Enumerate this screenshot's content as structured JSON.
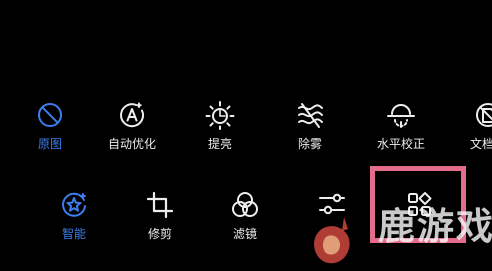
{
  "toolbar_row1": [
    {
      "label": "原图",
      "icon": "prohibited-circle-icon",
      "active": true
    },
    {
      "label": "自动优化",
      "icon": "auto-a-circle-icon",
      "active": false
    },
    {
      "label": "提亮",
      "icon": "sun-icon",
      "active": false
    },
    {
      "label": "除雾",
      "icon": "haze-icon",
      "active": false
    },
    {
      "label": "水平校正",
      "icon": "horizon-level-icon",
      "active": false
    },
    {
      "label": "文档去",
      "icon": "document-correct-icon",
      "active": false
    }
  ],
  "toolbar_row2": [
    {
      "label": "智能",
      "icon": "smart-star-icon",
      "active": true
    },
    {
      "label": "修剪",
      "icon": "crop-icon",
      "active": false
    },
    {
      "label": "滤镜",
      "icon": "filter-circles-icon",
      "active": false
    },
    {
      "label": "",
      "icon": "adjust-sliders-icon",
      "active": false
    },
    {
      "label": "",
      "icon": "more-grid-icon",
      "active": false
    }
  ],
  "watermark": {
    "text": "鹿游戏"
  },
  "colors": {
    "accent": "#3d7df0",
    "highlight": "#e56d8b",
    "text": "#ededed",
    "background": "#000000"
  }
}
